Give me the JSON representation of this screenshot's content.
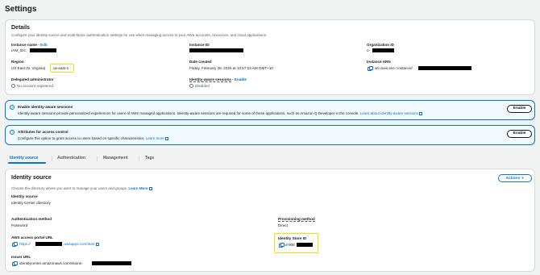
{
  "page": {
    "title": "Settings"
  },
  "details": {
    "title": "Details",
    "description": "Configure your identity source and multi-factor authentication settings for use when managing access to your AWS accounts, resources, and cloud applications.",
    "instance_name_label": "Instance name",
    "instance_name_sep": " - ",
    "instance_name_edit": "Edit",
    "instance_name_value": "IAM_IDC",
    "instance_id_label": "Instance ID",
    "org_id_label": "Organization ID",
    "org_id_value": "o-",
    "region_label": "Region",
    "region_value": "US East (N. Virginia)",
    "region_code": "us-east-1",
    "date_created_label": "Date created",
    "date_created_value": "Friday, February 28, 2025 at 10:57:23 AM GMT+10",
    "instance_arn_label": "Instance ARN",
    "instance_arn_value": "arn:aws:sso:::instance/",
    "delegated_admin_label": "Delegated administrator",
    "delegated_admin_value": "No account registered",
    "identity_aware_label": "Identity-aware sessions",
    "identity_aware_sep": " - ",
    "identity_aware_enable": "Enable",
    "identity_aware_value": "Disabled"
  },
  "alerts": [
    {
      "title": "Enable identity-aware sessions",
      "body": "Identity-aware sessions provide personalized experiences for users of AWS managed applications. Identity-aware sessions are required for some of these applications, such as Amazon Q Developer in the console.",
      "link": "Learn about identity-aware sessions",
      "button": "Enable"
    },
    {
      "title": "Attributes for access control",
      "body": "Configure this option to grant access to users based on specific characteristics.",
      "link": "Learn more",
      "button": "Enable"
    }
  ],
  "tabs": [
    "Identity source",
    "Authentication",
    "Management",
    "Tags"
  ],
  "identity_source": {
    "title": "Identity source",
    "description": "Choose the directory where you want to manage your users and groups.",
    "learn_more": "Learn More",
    "actions_button": "Actions",
    "source_label": "Identity source",
    "source_value": "Identity Center directory",
    "auth_method_label": "Authentication method",
    "auth_method_value": "Password",
    "provisioning_label": "Provisioning method",
    "provisioning_value": "Direct",
    "portal_url_label": "AWS access portal URL",
    "portal_url_prefix": "https://",
    "portal_url_suffix": ".awsapps.com/start",
    "store_id_label": "Identity Store ID",
    "store_id_value": "d-906",
    "issuer_label": "Issuer URL",
    "issuer_value": "identitycenter.amazonaws.com/ssoins-"
  },
  "colors": {
    "link": "#0972d3",
    "highlight": "#f2e200",
    "info_bg": "#f1faff"
  }
}
